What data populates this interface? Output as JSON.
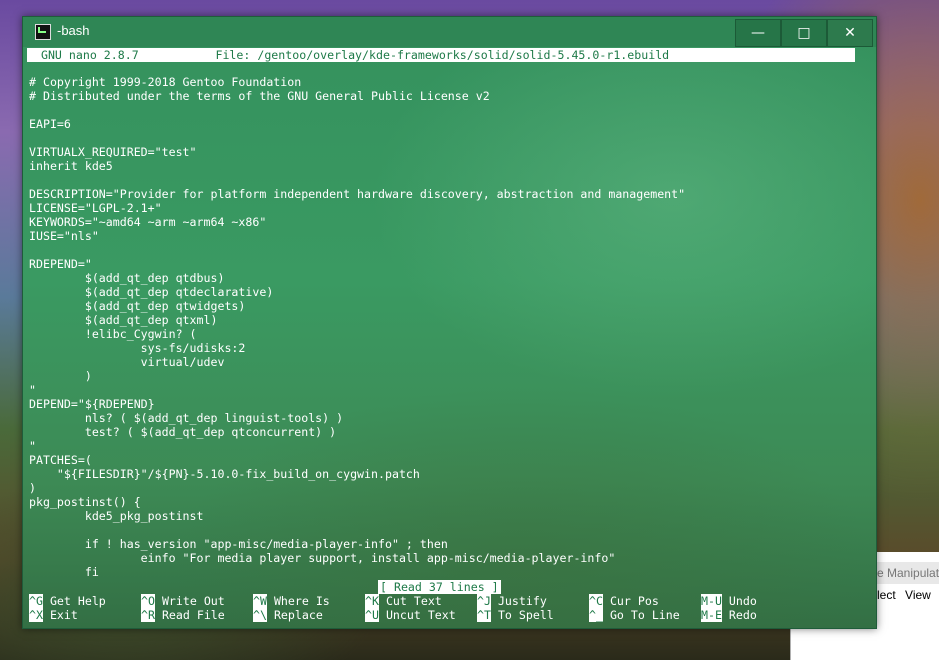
{
  "background_window": {
    "title_fragment": "e Manipulat",
    "menu": [
      "lect",
      "View"
    ]
  },
  "window": {
    "title": "-bash",
    "controls": {
      "minimize": "—",
      "maximize": "□",
      "close": "✕"
    }
  },
  "nano": {
    "header": "  GNU nano 2.8.7           File: /gentoo/overlay/kde-frameworks/solid/solid-5.45.0-r1.ebuild",
    "lines": [
      "# Copyright 1999-2018 Gentoo Foundation",
      "# Distributed under the terms of the GNU General Public License v2",
      "",
      "EAPI=6",
      "",
      "VIRTUALX_REQUIRED=\"test\"",
      "inherit kde5",
      "",
      "DESCRIPTION=\"Provider for platform independent hardware discovery, abstraction and management\"",
      "LICENSE=\"LGPL-2.1+\"",
      "KEYWORDS=\"~amd64 ~arm ~arm64 ~x86\"",
      "IUSE=\"nls\"",
      "",
      "RDEPEND=\"",
      "        $(add_qt_dep qtdbus)",
      "        $(add_qt_dep qtdeclarative)",
      "        $(add_qt_dep qtwidgets)",
      "        $(add_qt_dep qtxml)",
      "        !elibc_Cygwin? (",
      "                sys-fs/udisks:2",
      "                virtual/udev",
      "        )",
      "\"",
      "DEPEND=\"${RDEPEND}",
      "        nls? ( $(add_qt_dep linguist-tools) )",
      "        test? ( $(add_qt_dep qtconcurrent) )",
      "\"",
      "PATCHES=(",
      "    \"${FILESDIR}\"/${PN}-5.10.0-fix_build_on_cygwin.patch",
      ")",
      "pkg_postinst() {",
      "        kde5_pkg_postinst",
      "",
      "        if ! has_version \"app-misc/media-player-info\" ; then",
      "                einfo \"For media player support, install app-misc/media-player-info\"",
      "        fi"
    ],
    "status": "[ Read 37 lines ]",
    "shortcuts_row1": [
      {
        "key": "^G",
        "label": "Get Help"
      },
      {
        "key": "^O",
        "label": "Write Out"
      },
      {
        "key": "^W",
        "label": "Where Is"
      },
      {
        "key": "^K",
        "label": "Cut Text"
      },
      {
        "key": "^J",
        "label": "Justify"
      },
      {
        "key": "^C",
        "label": "Cur Pos"
      },
      {
        "key": "M-U",
        "label": "Undo"
      }
    ],
    "shortcuts_row2": [
      {
        "key": "^X",
        "label": "Exit"
      },
      {
        "key": "^R",
        "label": "Read File"
      },
      {
        "key": "^\\",
        "label": "Replace"
      },
      {
        "key": "^U",
        "label": "Uncut Text"
      },
      {
        "key": "^T",
        "label": "To Spell"
      },
      {
        "key": "^_",
        "label": "Go To Line"
      },
      {
        "key": "M-E",
        "label": "Redo"
      }
    ]
  }
}
